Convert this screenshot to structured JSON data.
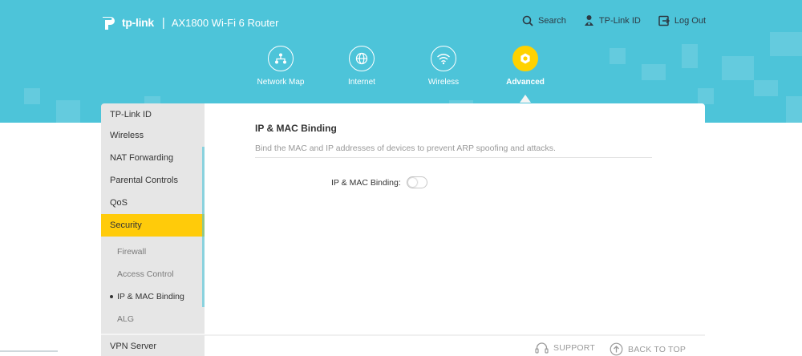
{
  "header": {
    "brand": "tp-link",
    "separator": "|",
    "model": "AX1800 Wi-Fi 6 Router",
    "links": [
      {
        "label": "Search",
        "icon": "search-icon"
      },
      {
        "label": "TP-Link ID",
        "icon": "user-icon"
      },
      {
        "label": "Log Out",
        "icon": "logout-icon"
      }
    ]
  },
  "nav": [
    {
      "label": "Network Map",
      "icon": "network-map-icon",
      "active": false
    },
    {
      "label": "Internet",
      "icon": "globe-icon",
      "active": false
    },
    {
      "label": "Wireless",
      "icon": "wifi-icon",
      "active": false
    },
    {
      "label": "Advanced",
      "icon": "gear-icon",
      "active": true
    }
  ],
  "sidebar": {
    "items": [
      {
        "label": "TP-Link ID"
      },
      {
        "label": "Wireless"
      },
      {
        "label": "NAT Forwarding"
      },
      {
        "label": "Parental Controls"
      },
      {
        "label": "QoS"
      },
      {
        "label": "Security",
        "active": true
      }
    ],
    "subitems": [
      {
        "label": "Firewall"
      },
      {
        "label": "Access Control"
      },
      {
        "label": "IP & MAC Binding",
        "current": true
      },
      {
        "label": "ALG"
      }
    ],
    "after": [
      {
        "label": "VPN Server"
      }
    ]
  },
  "content": {
    "title": "IP & MAC Binding",
    "description": "Bind the MAC and IP addresses of devices to prevent ARP spoofing and attacks.",
    "field_label": "IP & MAC Binding:",
    "toggle_on": false
  },
  "footer": {
    "support": "SUPPORT",
    "back_to_top": "BACK TO TOP"
  },
  "colors": {
    "header_bg": "#4dc4d9",
    "accent": "#ffd200",
    "sidebar_bg": "#e6e6e6",
    "active_item": "#ffcb0a"
  }
}
